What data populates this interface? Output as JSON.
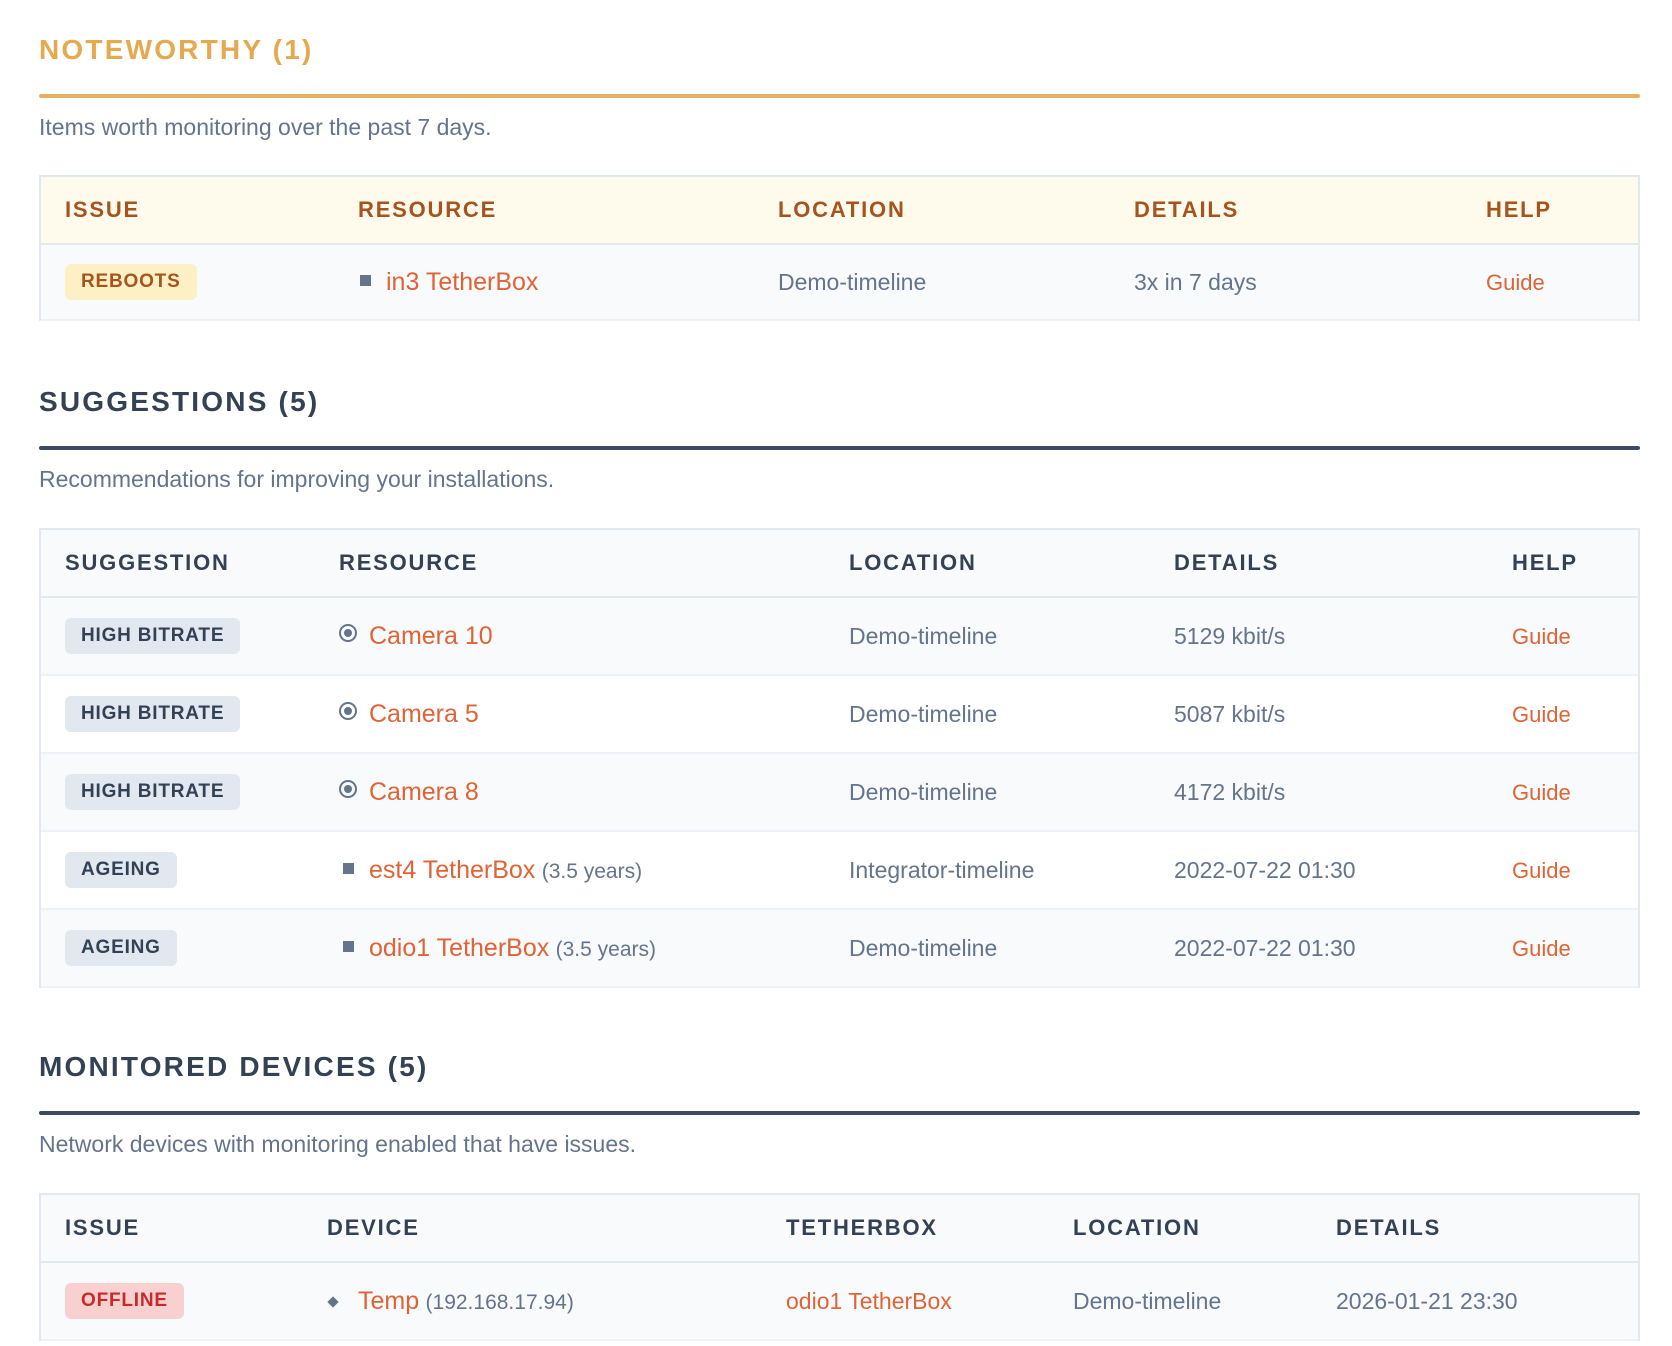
{
  "noteworthy": {
    "title": "NOTEWORTHY (1)",
    "description": "Items worth monitoring over the past 7 days.",
    "columns": [
      "ISSUE",
      "RESOURCE",
      "LOCATION",
      "DETAILS",
      "HELP"
    ],
    "rows": [
      {
        "badge": "REBOOTS",
        "resource": "in3 TetherBox",
        "location": "Demo-timeline",
        "details": "3x in 7 days",
        "help": "Guide"
      }
    ]
  },
  "suggestions": {
    "title": "SUGGESTIONS (5)",
    "description": "Recommendations for improving your installations.",
    "columns": [
      "SUGGESTION",
      "RESOURCE",
      "LOCATION",
      "DETAILS",
      "HELP"
    ],
    "rows": [
      {
        "badge": "HIGH BITRATE",
        "resource": "Camera 10",
        "extra": "",
        "location": "Demo-timeline",
        "details": "5129 kbit/s",
        "help": "Guide"
      },
      {
        "badge": "HIGH BITRATE",
        "resource": "Camera 5",
        "extra": "",
        "location": "Demo-timeline",
        "details": "5087 kbit/s",
        "help": "Guide"
      },
      {
        "badge": "HIGH BITRATE",
        "resource": "Camera 8",
        "extra": "",
        "location": "Demo-timeline",
        "details": "4172 kbit/s",
        "help": "Guide"
      },
      {
        "badge": "AGEING",
        "resource": "est4 TetherBox",
        "extra": "(3.5 years)",
        "location": "Integrator-timeline",
        "details": "2022-07-22 01:30",
        "help": "Guide"
      },
      {
        "badge": "AGEING",
        "resource": "odio1 TetherBox",
        "extra": "(3.5 years)",
        "location": "Demo-timeline",
        "details": "2022-07-22 01:30",
        "help": "Guide"
      }
    ]
  },
  "monitored": {
    "title": "MONITORED DEVICES (5)",
    "description": "Network devices with monitoring enabled that have issues.",
    "columns": [
      "ISSUE",
      "DEVICE",
      "TETHERBOX",
      "LOCATION",
      "DETAILS"
    ],
    "rows": [
      {
        "badge": "OFFLINE",
        "device": "Temp",
        "ip": "(192.168.17.94)",
        "tetherbox": "odio1 TetherBox",
        "location": "Demo-timeline",
        "details": "2026-01-21 23:30"
      }
    ]
  }
}
